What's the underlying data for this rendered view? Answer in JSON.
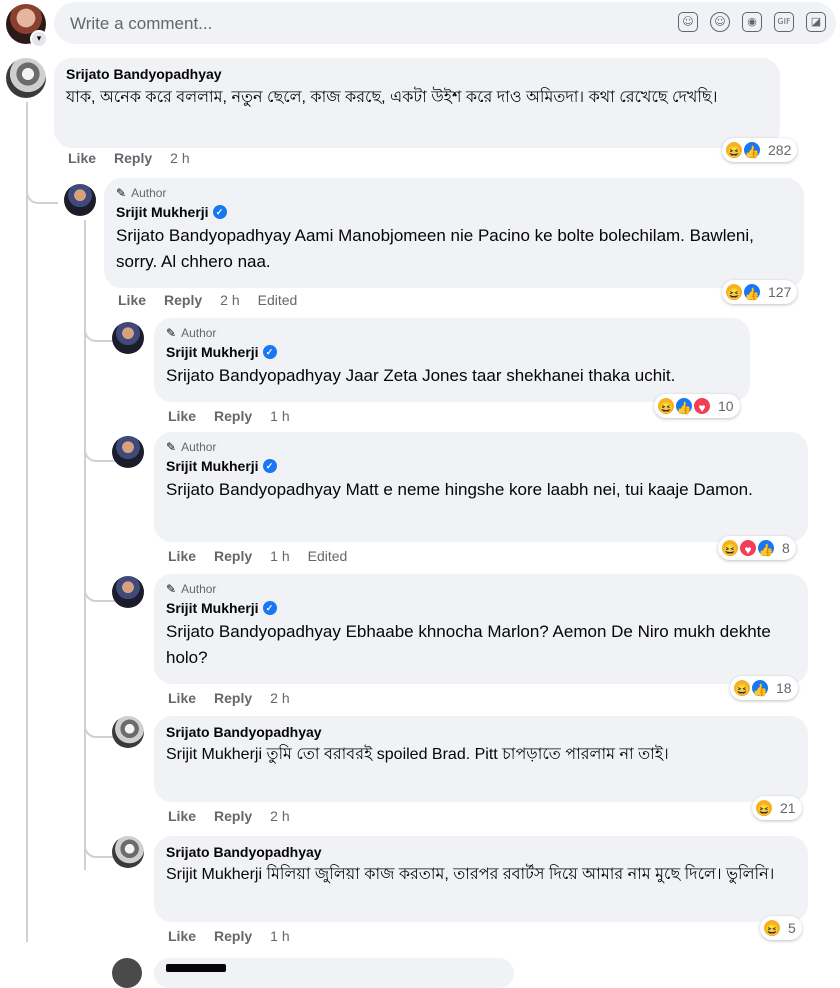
{
  "composer": {
    "placeholder": "Write a comment..."
  },
  "icons": [
    "avatar-sticker-icon",
    "emoji-icon",
    "camera-icon",
    "gif-icon",
    "sticker-icon"
  ],
  "comments": [
    {
      "author": "Srijato Bandyopadhyay",
      "author_badge": "",
      "text": "যাক, অনেক করে বললাম, নতুন ছেলে, কাজ করছে, একটা উইশ করে দাও অমিতদা। কথা রেখেছে দেখছি।",
      "like": "Like",
      "reply": "Reply",
      "time": "2 h",
      "edited": "",
      "reactions": [
        "haha",
        "like"
      ],
      "count": "282"
    },
    {
      "author": "Srijit Mukherji",
      "author_badge": "Author",
      "text": "Srijato Bandyopadhyay Aami Manobjomeen nie Pacino ke bolte bolechilam. Bawleni, sorry. Al chhero naa.",
      "like": "Like",
      "reply": "Reply",
      "time": "2 h",
      "edited": "Edited",
      "reactions": [
        "haha",
        "like"
      ],
      "count": "127"
    },
    {
      "author": "Srijit Mukherji",
      "author_badge": "Author",
      "text": "Srijato Bandyopadhyay Jaar Zeta Jones taar shekhanei thaka uchit.",
      "like": "Like",
      "reply": "Reply",
      "time": "1 h",
      "edited": "",
      "reactions": [
        "haha",
        "like",
        "love"
      ],
      "count": "10"
    },
    {
      "author": "Srijit Mukherji",
      "author_badge": "Author",
      "text": "Srijato Bandyopadhyay Matt e neme hingshe kore laabh nei, tui kaaje Damon.",
      "like": "Like",
      "reply": "Reply",
      "time": "1 h",
      "edited": "Edited",
      "reactions": [
        "haha",
        "love",
        "like"
      ],
      "count": "8"
    },
    {
      "author": "Srijit Mukherji",
      "author_badge": "Author",
      "text": "Srijato Bandyopadhyay Ebhaabe khnocha Marlon? Aemon De Niro mukh dekhte holo?",
      "like": "Like",
      "reply": "Reply",
      "time": "2 h",
      "edited": "",
      "reactions": [
        "haha",
        "like"
      ],
      "count": "18"
    },
    {
      "author": "Srijato Bandyopadhyay",
      "author_badge": "",
      "text": "Srijit Mukherji তুমি তো বরাবরই spoiled Brad. Pitt চাপড়াতে পারলাম না তাই।",
      "like": "Like",
      "reply": "Reply",
      "time": "2 h",
      "edited": "",
      "reactions": [
        "haha"
      ],
      "count": "21"
    },
    {
      "author": "Srijato Bandyopadhyay",
      "author_badge": "",
      "text": "Srijit Mukherji মিলিয়া জুলিয়া কাজ করতাম, তারপর রবার্টস দিয়ে আমার নাম মুছে দিলে। ভুলিনি।",
      "like": "Like",
      "reply": "Reply",
      "time": "1 h",
      "edited": "",
      "reactions": [
        "haha"
      ],
      "count": "5"
    }
  ]
}
